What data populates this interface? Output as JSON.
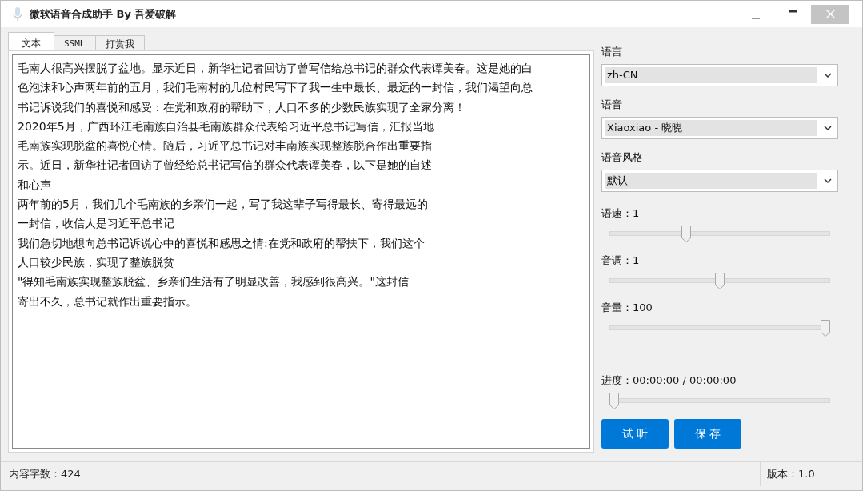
{
  "window": {
    "title": "微软语音合成助手 By 吾爱破解"
  },
  "tabs": [
    {
      "label": "文本",
      "selected": true
    },
    {
      "label": "SSML",
      "selected": false
    },
    {
      "label": "打赏我",
      "selected": false
    }
  ],
  "text_area": {
    "lines": [
      "毛南人很高兴摆脱了盆地。显示近日，新华社记者回访了曾写信给总书记的群众代表谭美春。这是她的白",
      "色泡沫和心声两年前的五月，我们毛南村的几位村民写下了我一生中最长、最远的一封信，我们渴望向总",
      "书记诉说我们的喜悦和感受：在党和政府的帮助下，人口不多的少数民族实现了全家分离！",
      "2020年5月，广西环江毛南族自治县毛南族群众代表给习近平总书记写信，汇报当地",
      "毛南族实现脱盆的喜悦心情。随后，习近平总书记对丰南族实现整族脱合作出重要指",
      "示。近日，新华社记者回访了曾经给总书记写信的群众代表谭美春，以下是她的自述",
      "和心声——",
      "两年前的5月，我们几个毛南族的乡亲们一起，写了我这辈子写得最长、寄得最远的",
      "一封信，收信人是习近平总书记",
      "我们急切地想向总书记诉说心中的喜悦和感思之情:在党和政府的帮扶下，我们这个",
      "人口较少民族，实现了整族脱贫",
      "\"得知毛南族实现整族脱盆、乡亲们生活有了明显改善，我感到很高兴。\"这封信",
      "寄出不久，总书记就作出重要指示。"
    ]
  },
  "settings": {
    "dropdowns": [
      {
        "label": "语言",
        "value": "zh-CN"
      },
      {
        "label": "语音",
        "value": "Xiaoxiao - 晓晓"
      },
      {
        "label": "语音风格",
        "value": "默认"
      }
    ],
    "sliders": [
      {
        "label": "语速：1",
        "level": 0.34
      },
      {
        "label": "音调：1",
        "level": 0.5
      },
      {
        "label": "音量：100",
        "level": 1
      },
      {
        "label": "进度：00:00:00 / 00:00:00",
        "level": 0
      }
    ],
    "buttons": [
      "试 听",
      "保 存"
    ]
  },
  "status_bar": {
    "char_count": "内容字数：424",
    "version": "版本：1.0"
  }
}
